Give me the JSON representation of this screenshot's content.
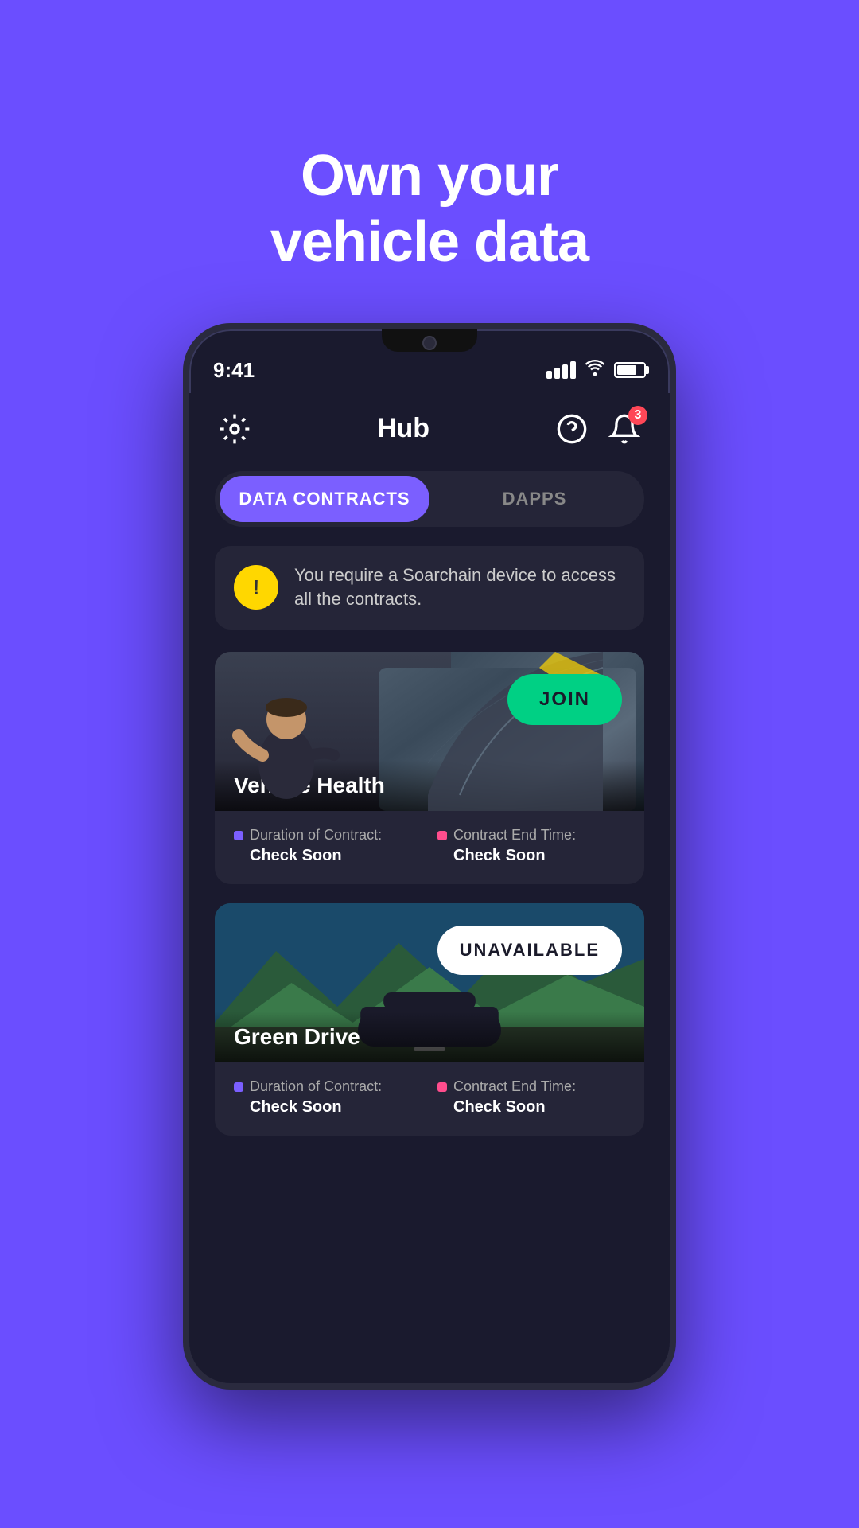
{
  "hero": {
    "title_line1": "Own your",
    "title_line2": "vehicle data"
  },
  "status_bar": {
    "time": "9:41",
    "notification_count": "3"
  },
  "header": {
    "title": "Hub"
  },
  "tabs": [
    {
      "id": "data-contracts",
      "label": "DATA CONTRACTS",
      "active": true
    },
    {
      "id": "dapps",
      "label": "DAPPS",
      "active": false
    }
  ],
  "alert": {
    "icon": "!",
    "message": "You require a Soarchain device to access all the contracts."
  },
  "contracts": [
    {
      "id": "vehicle-health",
      "title": "Vehicle Health",
      "button_label": "JOIN",
      "button_type": "join",
      "duration_label": "Duration of Contract:",
      "duration_value": "Check Soon",
      "end_time_label": "Contract End Time:",
      "end_time_value": "Check Soon"
    },
    {
      "id": "green-drive",
      "title": "Green Drive",
      "button_label": "UNAVAILABLE",
      "button_type": "unavailable",
      "duration_label": "Duration of Contract:",
      "duration_value": "Check Soon",
      "end_time_label": "Contract End Time:",
      "end_time_value": "Check Soon"
    }
  ],
  "colors": {
    "background": "#6B4EFF",
    "phone_bg": "#1a1a2e",
    "card_bg": "#252538",
    "join_btn": "#00D084",
    "unavail_btn": "#ffffff",
    "tab_active": "#7B5FFF",
    "badge": "#ff4757"
  }
}
